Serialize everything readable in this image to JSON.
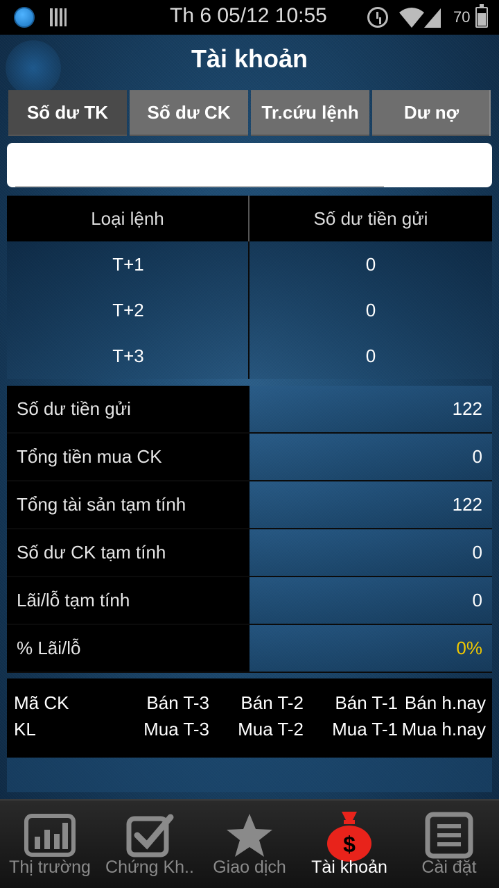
{
  "status_bar": {
    "datetime": "Th 6 05/12 10:55",
    "battery": "70"
  },
  "header": {
    "title": "Tài khoản"
  },
  "tabs": [
    {
      "label": "Số dư TK",
      "active": true
    },
    {
      "label": "Số dư CK",
      "active": false
    },
    {
      "label": "Tr.cứu lệnh",
      "active": false
    },
    {
      "label": "Dư nợ",
      "active": false
    }
  ],
  "search": {
    "value": "",
    "placeholder": ""
  },
  "settlement_table": {
    "headers": [
      "Loại lệnh",
      "Số dư tiền gửi"
    ],
    "rows": [
      {
        "type": "T+1",
        "balance": "0"
      },
      {
        "type": "T+2",
        "balance": "0"
      },
      {
        "type": "T+3",
        "balance": "0"
      }
    ]
  },
  "summary": [
    {
      "label": "Số dư tiền gửi",
      "value": "122"
    },
    {
      "label": "Tổng tiền mua CK",
      "value": "0"
    },
    {
      "label": "Tổng tài sản tạm tính",
      "value": "122"
    },
    {
      "label": "Số dư CK tạm tính",
      "value": "0"
    },
    {
      "label": "Lãi/lỗ tạm tính",
      "value": "0"
    },
    {
      "label": "% Lãi/lỗ",
      "value": "0%",
      "color": "#f0c800"
    }
  ],
  "stock_table_header": {
    "line1": [
      "Mã CK",
      "Bán T-3",
      "Bán T-2",
      "Bán T-1",
      "Bán h.nay"
    ],
    "line2": [
      "KL",
      "Mua T-3",
      "Mua T-2",
      "Mua T-1",
      "Mua h.nay"
    ]
  },
  "bottom_nav": [
    {
      "label": "Thị trường",
      "icon": "bar-chart-icon",
      "active": false
    },
    {
      "label": "Chứng Kh..",
      "icon": "checkbox-icon",
      "active": false
    },
    {
      "label": "Giao dịch",
      "icon": "star-icon",
      "active": false
    },
    {
      "label": "Tài khoản",
      "icon": "money-bag-icon",
      "active": true,
      "accent": "#e8231b"
    },
    {
      "label": "Cài đặt",
      "icon": "list-icon",
      "active": false
    }
  ]
}
